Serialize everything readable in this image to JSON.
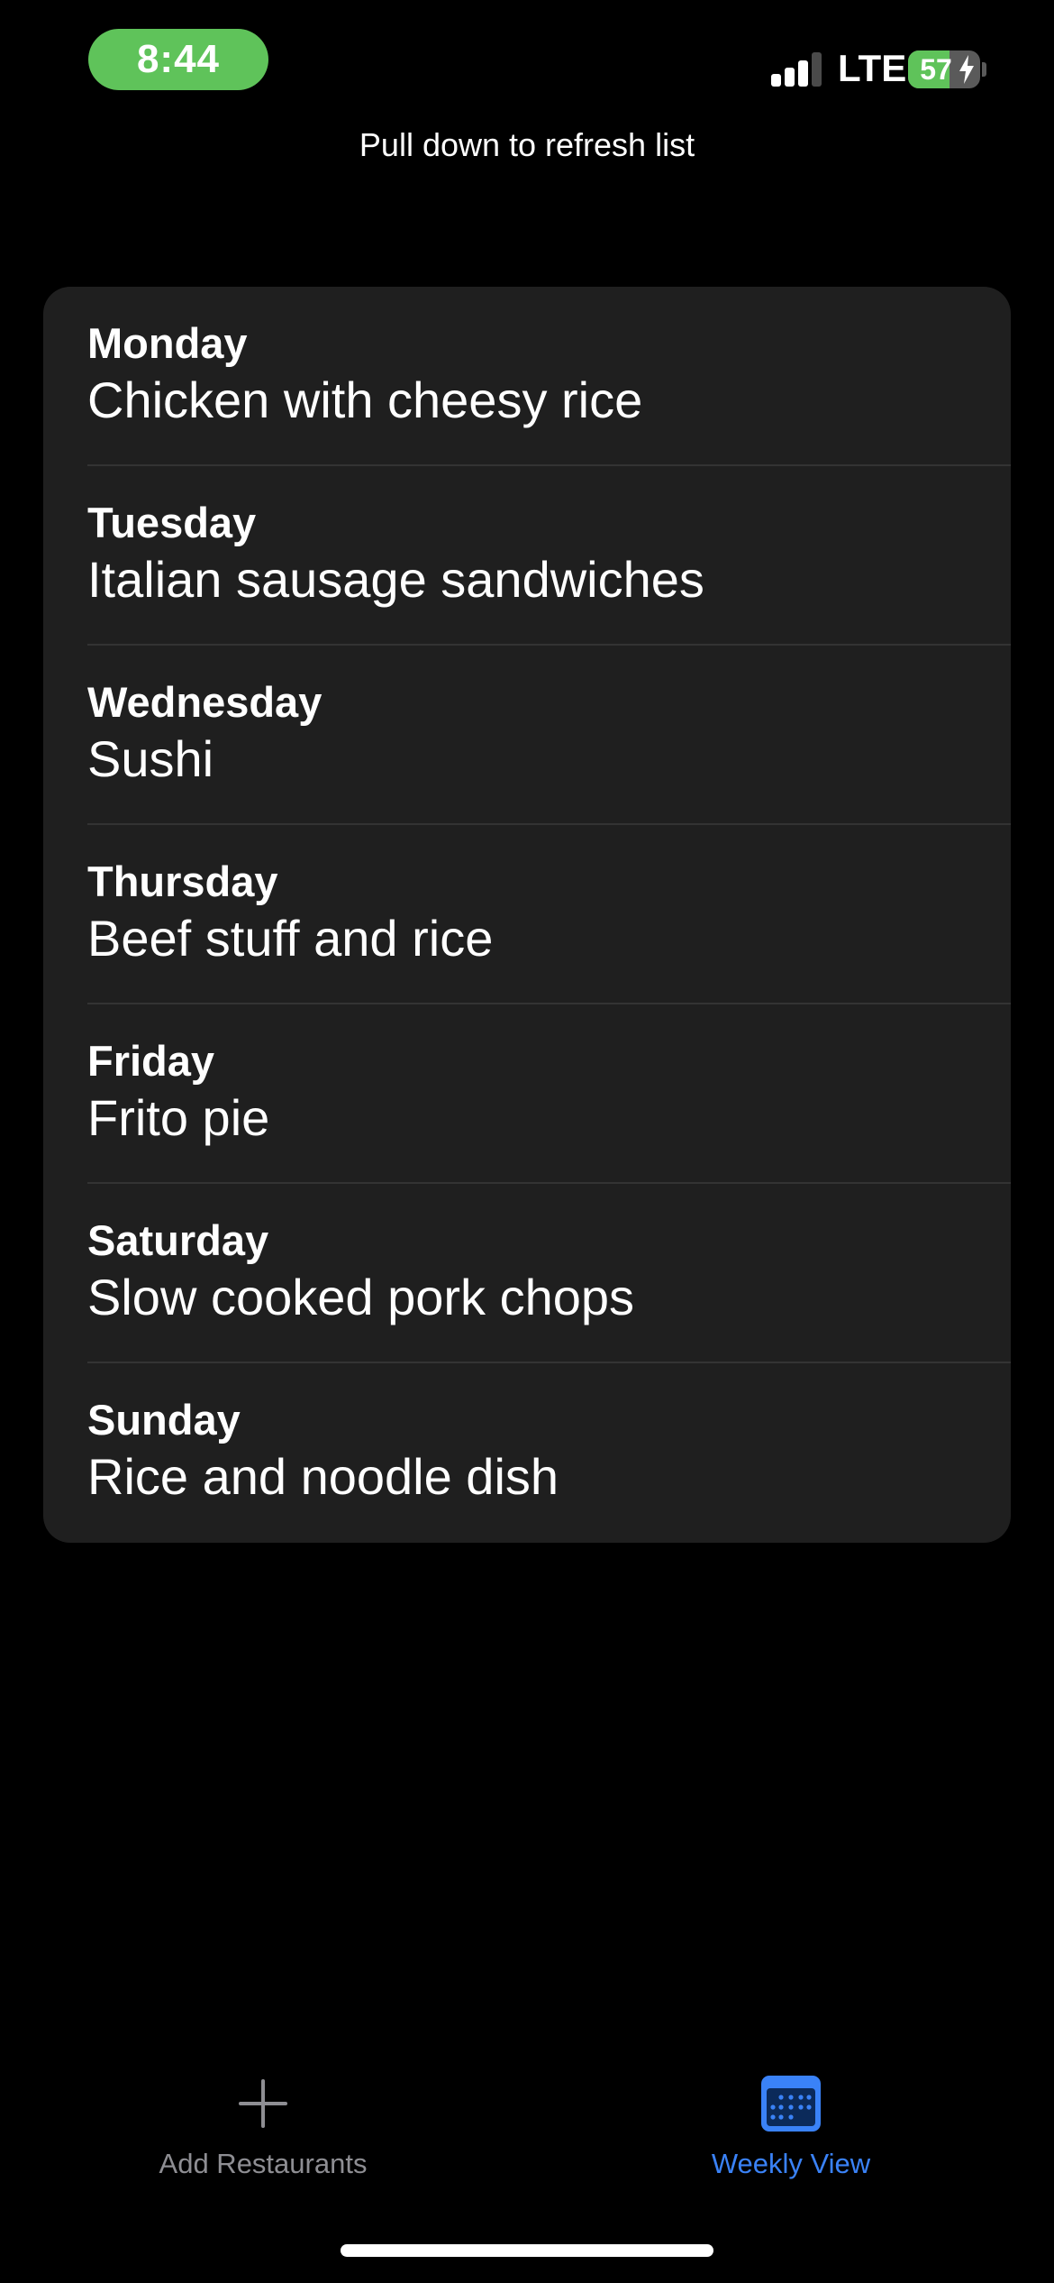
{
  "status_bar": {
    "time": "8:44",
    "network": "LTE",
    "battery": "57",
    "battery_level": 0.57,
    "charging": true,
    "signal_bars_active": 3,
    "signal_bars_total": 4,
    "accent_color": "#5fc35a"
  },
  "refresh_hint": "Pull down to refresh list",
  "meals": [
    {
      "day": "Monday",
      "meal": "Chicken with cheesy rice"
    },
    {
      "day": "Tuesday",
      "meal": "Italian sausage sandwiches"
    },
    {
      "day": "Wednesday",
      "meal": "Sushi"
    },
    {
      "day": "Thursday",
      "meal": "Beef stuff and rice"
    },
    {
      "day": "Friday",
      "meal": "Frito pie"
    },
    {
      "day": "Saturday",
      "meal": "Slow cooked pork chops"
    },
    {
      "day": "Sunday",
      "meal": "Rice and noodle dish"
    }
  ],
  "tab_bar": {
    "tabs": [
      {
        "label": "Add Restaurants",
        "icon": "plus-icon",
        "selected": false
      },
      {
        "label": "Weekly View",
        "icon": "calendar-icon",
        "selected": true
      }
    ],
    "selected_color": "#3a82f7",
    "unselected_color": "#8e8e93"
  }
}
